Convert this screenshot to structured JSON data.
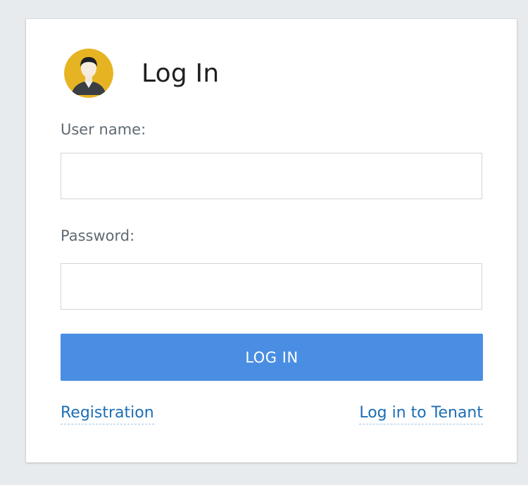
{
  "header": {
    "title": "Log In",
    "avatar_icon": "user-avatar-icon"
  },
  "form": {
    "username_label": "User name:",
    "username_value": "",
    "password_label": "Password:",
    "password_value": "",
    "submit_label": "LOG IN"
  },
  "links": {
    "registration": "Registration",
    "tenant_login": "Log in to Tenant"
  },
  "colors": {
    "background": "#e8ebee",
    "card": "#ffffff",
    "button": "#4a8ee3",
    "link": "#1b6eb5",
    "avatar_bg": "#e6b422"
  }
}
